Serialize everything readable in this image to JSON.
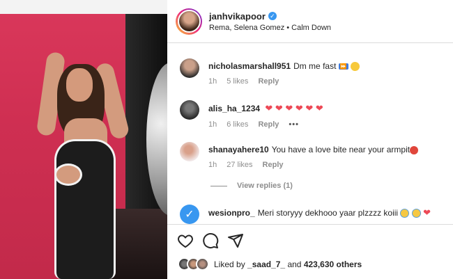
{
  "post": {
    "username": "janhvikapoor",
    "audio": "Rema, Selena Gomez • Calm Down"
  },
  "comments": [
    {
      "user": "nicholasmarshall951",
      "text": "Dm me fast",
      "emojis": "fast-forward-emoji, tongue-face-emoji",
      "time": "1h",
      "likes": "5 likes",
      "reply": "Reply"
    },
    {
      "user": "alis_ha_1234",
      "text": "",
      "emojis": "six red hearts",
      "hearts": "❤ ❤ ❤ ❤ ❤ ❤",
      "time": "1h",
      "likes": "6 likes",
      "reply": "Reply",
      "more": "•••"
    },
    {
      "user": "shanayahere10",
      "text": "You have a love bite near your armpit",
      "emojis": "angry-face-emoji",
      "time": "1h",
      "likes": "27 likes",
      "reply": "Reply"
    },
    {
      "user": "wesionpro_",
      "text": "Meri storyyy dekhooo yaar plzzzz koiii",
      "emojis": "crying-emoji, crying-emoji, red-heart"
    }
  ],
  "view_replies": "View replies (1)",
  "liked_by": {
    "prefix": "Liked by",
    "user": "_saad_7_",
    "middle": "and",
    "others": "423,630 others"
  },
  "colors": {
    "verified": "#3897f0",
    "heart": "#ed4956",
    "muted": "#8e8e8e"
  }
}
